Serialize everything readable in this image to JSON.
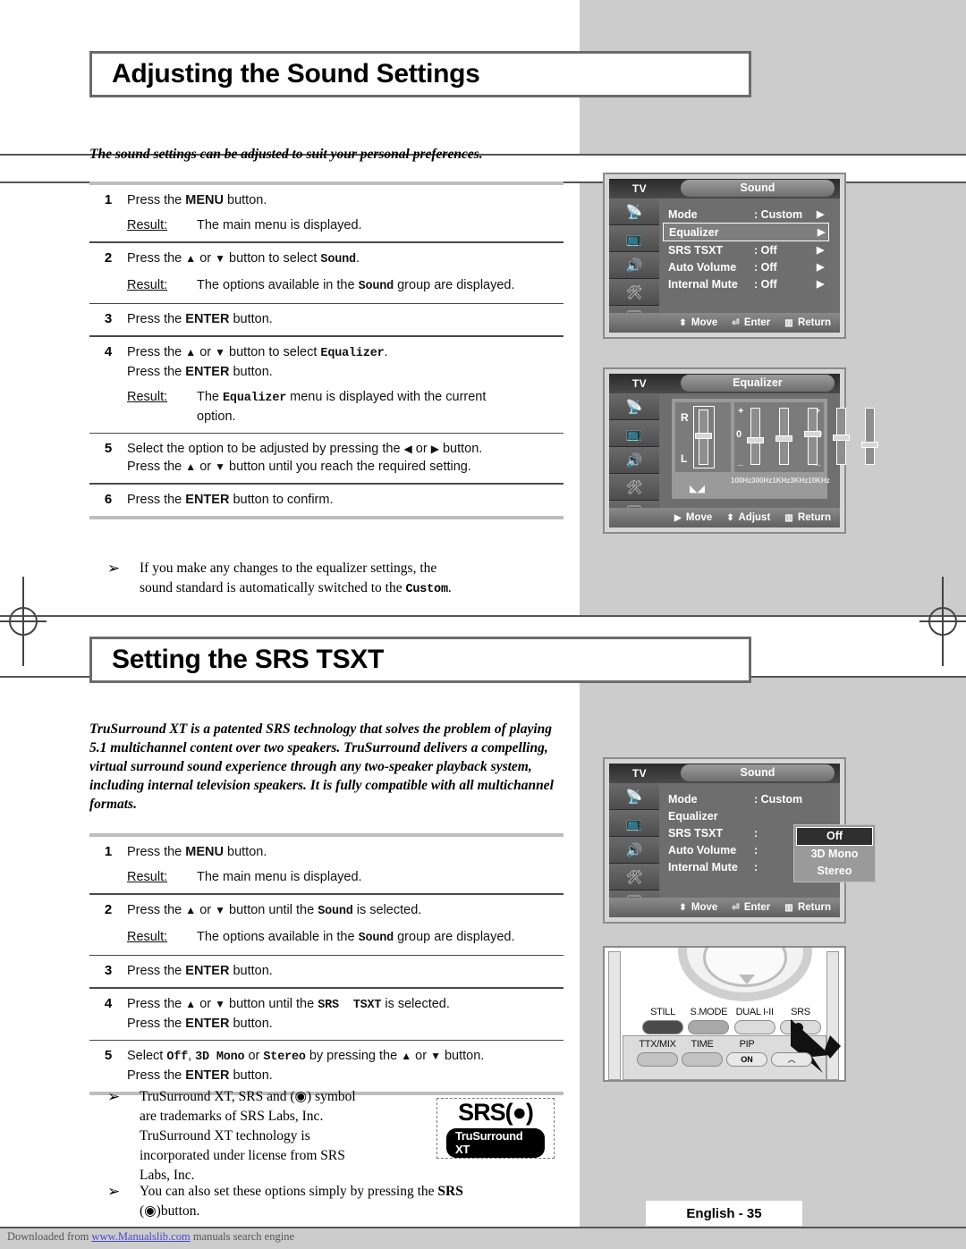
{
  "sections": [
    {
      "title": "Adjusting the Sound Settings",
      "intro": "The sound settings can be adjusted to suit your personal preferences.",
      "steps": [
        {
          "num": "1",
          "lines": [
            "Press the MENU button."
          ],
          "result": {
            "label": "Result:",
            "text": "The main menu is displayed."
          }
        },
        {
          "num": "2",
          "lines": [
            "Press the ▲ or ▼ button to select Sound."
          ],
          "result": {
            "label": "Result:",
            "text": "The options available in the Sound group are displayed."
          }
        },
        {
          "num": "3",
          "lines": [
            "Press the ENTER button."
          ],
          "result": null
        },
        {
          "num": "4",
          "lines": [
            "Press the ▲ or ▼ button to select Equalizer.",
            "Press the ENTER button."
          ],
          "result": {
            "label": "Result:",
            "text": "The Equalizer menu is displayed with the current option."
          }
        },
        {
          "num": "5",
          "lines": [
            "Select the option to be adjusted by pressing the ◀ or ▶ button.",
            "Press the ▲ or ▼ button until you reach the required setting."
          ],
          "result": null
        },
        {
          "num": "6",
          "lines": [
            "Press the ENTER button to confirm."
          ],
          "result": null
        }
      ],
      "notes": [
        {
          "bullet": "➢",
          "lines": [
            "If you make any changes to the equalizer settings, the",
            "sound standard is automatically switched to the Custom."
          ]
        }
      ]
    },
    {
      "title": "Setting the SRS TSXT",
      "intro": "TruSurround XT is a patented SRS technology that solves the problem of playing 5.1 multichannel content over two speakers. TruSurround delivers a compelling, virtual surround sound experience through any two-speaker playback system, including internal television speakers. It is fully compatible with all multichannel formats.",
      "steps": [
        {
          "num": "1",
          "lines": [
            "Press the MENU button."
          ],
          "result": {
            "label": "Result:",
            "text": "The main menu is displayed."
          }
        },
        {
          "num": "2",
          "lines": [
            "Press the ▲ or ▼ button until the Sound is selected."
          ],
          "result": {
            "label": "Result:",
            "text": "The options available in the Sound group are displayed."
          }
        },
        {
          "num": "3",
          "lines": [
            "Press the ENTER button."
          ],
          "result": null
        },
        {
          "num": "4",
          "lines": [
            "Press the ▲ or ▼ button until the SRS TSXT is selected.",
            "Press the ENTER button."
          ],
          "result": null
        },
        {
          "num": "5",
          "lines": [
            "Select Off, 3D Mono or Stereo  by pressing the ▲ or ▼ button.",
            "Press the ENTER button."
          ],
          "result": null
        }
      ],
      "notes": [
        {
          "bullet": "➢",
          "lines": [
            "TruSurround XT, SRS and (◉) symbol",
            "are trademarks of SRS Labs, Inc.",
            "TruSurround XT technology is",
            "incorporated under license from SRS",
            "Labs, Inc."
          ]
        },
        {
          "bullet": "➢",
          "lines": [
            "You can also set these options simply by pressing the SRS",
            "(◉)button."
          ]
        }
      ]
    }
  ],
  "osd_sound_1": {
    "tv_label": "TV",
    "menu_title": "Sound",
    "rows": [
      {
        "label": "Mode",
        "value": ": Custom",
        "arrow": "▶",
        "selected": false
      },
      {
        "label": "Equalizer",
        "value": "",
        "arrow": "▶",
        "selected": true
      },
      {
        "label": "SRS TSXT",
        "value": ": Off",
        "arrow": "▶",
        "selected": false
      },
      {
        "label": "Auto Volume",
        "value": ": Off",
        "arrow": "▶",
        "selected": false
      },
      {
        "label": "Internal Mute",
        "value": ": Off",
        "arrow": "▶",
        "selected": false
      }
    ],
    "footer": {
      "move": "Move",
      "enter": "Enter",
      "return": "Return"
    }
  },
  "osd_equalizer": {
    "tv_label": "TV",
    "menu_title": "Equalizer",
    "channel_top": "R",
    "channel_bottom": "L",
    "plus": "+",
    "minus": "_",
    "zero": "0",
    "band_labels": [
      "100Hz",
      "300Hz",
      "1KHz",
      "3KHz",
      "10KHz"
    ],
    "balance_value": 50,
    "band_values": [
      62,
      58,
      48,
      55,
      70
    ],
    "footer": {
      "move": "Move",
      "adjust": "Adjust",
      "return": "Return"
    }
  },
  "osd_sound_2": {
    "tv_label": "TV",
    "menu_title": "Sound",
    "rows": [
      {
        "label": "Mode",
        "value": ": Custom"
      },
      {
        "label": "Equalizer",
        "value": ""
      },
      {
        "label": "SRS TSXT",
        "value": ":"
      },
      {
        "label": "Auto Volume",
        "value": ":"
      },
      {
        "label": "Internal Mute",
        "value": ":"
      }
    ],
    "dropdown": [
      {
        "label": "Off",
        "highlighted": true
      },
      {
        "label": "3D Mono",
        "highlighted": false
      },
      {
        "label": "Stereo",
        "highlighted": false
      }
    ],
    "footer": {
      "move": "Move",
      "enter": "Enter",
      "return": "Return"
    }
  },
  "remote": {
    "top_buttons": [
      "STILL",
      "S.MODE",
      "DUAL I-II",
      "SRS"
    ],
    "bottom_buttons": [
      "TTX/MIX",
      "TIME",
      "PIP"
    ],
    "pip_on_label": "ON"
  },
  "srs_logo": {
    "wordmark": "SRS",
    "symbol": "(●)",
    "tagline": "TruSurround XT"
  },
  "page_label": "English - 35",
  "download_footer": {
    "prefix": "Downloaded from ",
    "link": "www.Manualslib.com",
    "suffix": "  manuals search engine"
  }
}
